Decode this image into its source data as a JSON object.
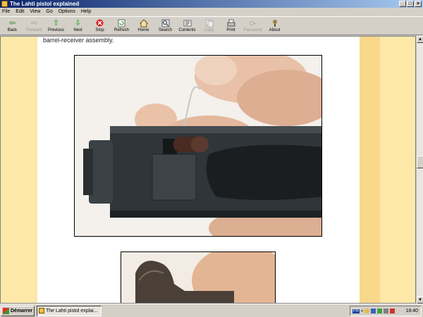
{
  "window": {
    "title": "The Lahti pistol explained"
  },
  "menu": [
    "File",
    "Edit",
    "View",
    "Go",
    "Options",
    "Help"
  ],
  "toolbar": [
    {
      "label": "Back",
      "icon": "back-arrow-icon",
      "enabled": true
    },
    {
      "label": "Forward",
      "icon": "forward-arrow-icon",
      "enabled": false
    },
    {
      "label": "Previous",
      "icon": "previous-up-arrow-icon",
      "enabled": true
    },
    {
      "label": "Next",
      "icon": "next-down-arrow-icon",
      "enabled": true
    },
    {
      "label": "Stop",
      "icon": "stop-icon",
      "enabled": true
    },
    {
      "label": "Refresh",
      "icon": "refresh-icon",
      "enabled": true
    },
    {
      "label": "Home",
      "icon": "home-icon",
      "enabled": true
    },
    {
      "label": "Search",
      "icon": "search-icon",
      "enabled": true
    },
    {
      "label": "Contents",
      "icon": "contents-icon",
      "enabled": true
    },
    {
      "label": "Copy",
      "icon": "copy-icon",
      "enabled": false
    },
    {
      "label": "Print",
      "icon": "print-icon",
      "enabled": true
    },
    {
      "label": "Password",
      "icon": "password-icon",
      "enabled": false
    },
    {
      "label": "About",
      "icon": "about-icon",
      "enabled": true
    }
  ],
  "content": {
    "top_text": "barrel-receiver assembly."
  },
  "taskbar": {
    "start_label": "Démarrer",
    "task_label": "The Lahti pistol explai...",
    "lang": "FR",
    "clock": "18:40"
  },
  "colors": {
    "stripe_light": "#fde8a8",
    "stripe_dark": "#f8d88a",
    "title_gradient_start": "#0a246a"
  }
}
